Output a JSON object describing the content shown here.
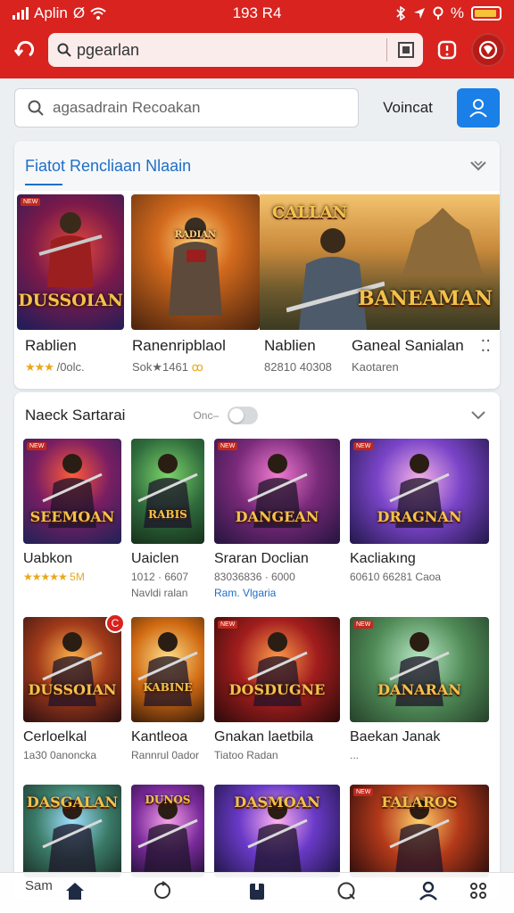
{
  "status_bar": {
    "carrier": "Aplin",
    "carrier_suffix": "Ø",
    "time": "193 R4",
    "battery_label": "%",
    "battery_level": 0.8
  },
  "browser": {
    "url": "pgearlan",
    "back_icon": "back-arrow-icon",
    "colors": {
      "bar": "#d8231f"
    }
  },
  "search": {
    "placeholder": "agasadrain Recoakan",
    "vote_label": "Voincat"
  },
  "featured": {
    "title": "Fiatot Rencliaan Nlaain",
    "tiles": [
      {
        "art_text": "DUSSOIAN",
        "tag": "NEW"
      },
      {
        "art_text": "RADIAN",
        "tag": ""
      },
      {
        "art_text": "BANEAMAN",
        "logo": "CALLAN"
      }
    ],
    "items": [
      {
        "name": "Rablien",
        "rating_stars": "★★★",
        "meta": "/0olc."
      },
      {
        "name": "Ranenripblaol",
        "meta": "Sok★1461",
        "extra": "ꝏ"
      },
      {
        "name": "Nablien",
        "meta": "82810 40308"
      },
      {
        "name": "Ganeal Sanialan",
        "meta": "Kaotaren"
      }
    ]
  },
  "section2": {
    "title": "Naeck Sartarai",
    "sort_label": "Onc–",
    "toggle_on": false,
    "items": [
      {
        "name": "Uabkon",
        "meta": "★★★★★ 5M",
        "art_text": "SEEMOAN",
        "tag": "NEW"
      },
      {
        "name": "Uaiclen",
        "meta": "1012 · 6607",
        "meta2": "Navldi ralan",
        "art_text": "RABIS",
        "tag": ""
      },
      {
        "name": "Sraran Doclian",
        "meta": "83036836 · 6000",
        "meta2": "Ram. Vlgaria",
        "art_text": "DANGEAN",
        "tag": "NEW"
      },
      {
        "name": "Kacliakıng",
        "meta": "60610 66281 Caoa",
        "art_text": "DRAGNAN",
        "tag": "NEW"
      },
      {
        "name": "Cerloelkal",
        "meta": "1a30 0anoncka",
        "art_text": "DUSSOIAN",
        "badge": "C"
      },
      {
        "name": "Kantleoa",
        "meta": "Rannrul 0ador",
        "art_text": "KABINE",
        "tag": ""
      },
      {
        "name": "Gnakan laetbila",
        "meta": "Tiatoo Radan",
        "art_text": "DOSDUGNE",
        "tag": "NEW"
      },
      {
        "name": "Baekan Janak",
        "meta": "...",
        "art_text": "DANARAN",
        "tag": "NEW"
      },
      {
        "name": "",
        "meta": "",
        "art_text": "DASGALAN",
        "tag": ""
      },
      {
        "name": "",
        "meta": "",
        "art_text": "DUNOS",
        "tag": ""
      },
      {
        "name": "",
        "meta": "",
        "art_text": "DASMOAN",
        "tag": ""
      },
      {
        "name": "",
        "meta": "",
        "art_text": "FALAROS",
        "tag": "NEW"
      }
    ]
  },
  "bottom_nav": {
    "label": "Sam",
    "items": [
      "home-icon",
      "refresh-icon",
      "library-icon",
      "search-icon",
      "profile-icon",
      "settings-icon"
    ]
  }
}
